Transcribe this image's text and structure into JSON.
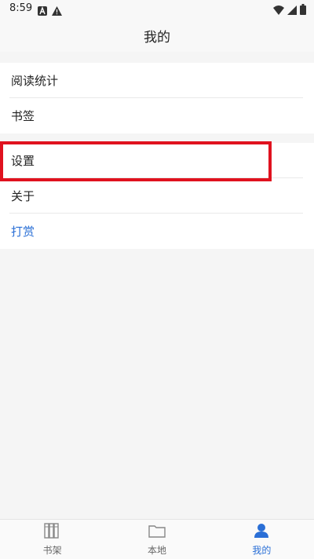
{
  "status_bar": {
    "time": "8:59",
    "left_icons": [
      "a-badge-icon",
      "warning-icon"
    ],
    "right_icons": [
      "wifi-icon",
      "signal-icon",
      "battery-icon"
    ]
  },
  "app_bar": {
    "title": "我的"
  },
  "menu": {
    "section1": [
      {
        "label": "阅读统计"
      },
      {
        "label": "书签"
      }
    ],
    "section2": [
      {
        "label": "设置"
      },
      {
        "label": "关于"
      },
      {
        "label": "打赏"
      }
    ]
  },
  "bottom_nav": [
    {
      "label": "书架",
      "icon": "bookshelf-icon"
    },
    {
      "label": "本地",
      "icon": "folder-icon"
    },
    {
      "label": "我的",
      "icon": "person-icon",
      "active": true
    }
  ],
  "colors": {
    "accent": "#2a6fd6",
    "highlight": "#e0121f",
    "background": "#f5f5f5"
  }
}
